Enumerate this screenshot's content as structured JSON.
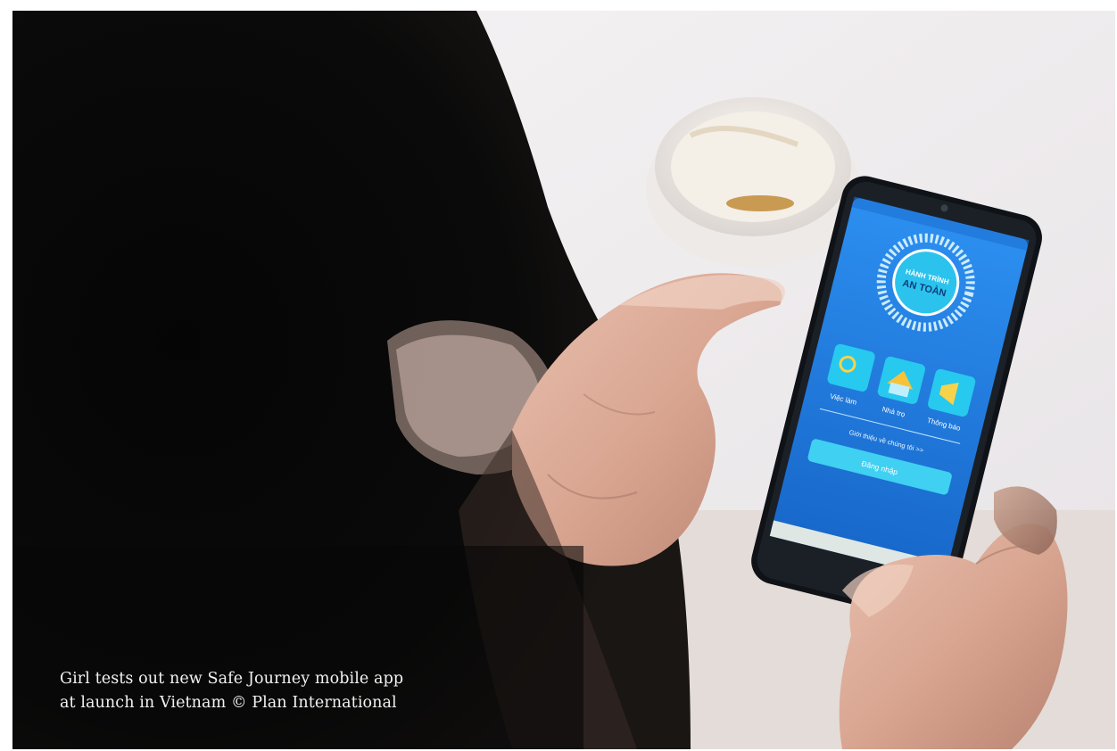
{
  "caption": {
    "line1": "Girl tests out new Safe Journey mobile app",
    "line2": "at launch in Vietnam © Plan International"
  },
  "phone_app": {
    "logo_line1": "HÀNH TRÌNH",
    "logo_line2": "AN TOÀN",
    "tiles": [
      {
        "label": "Việc làm",
        "icon": "job-search-icon"
      },
      {
        "label": "Nhà trọ",
        "icon": "housing-icon"
      },
      {
        "label": "Thông báo",
        "icon": "megaphone-icon"
      }
    ],
    "about_link": "Giới thiệu về chúng tôi >>",
    "login_button": "Đăng nhập"
  },
  "colors": {
    "app_blue": "#1e7fe0",
    "tile_cyan": "#27c9ee",
    "background_dark": "#0b0b0b"
  }
}
